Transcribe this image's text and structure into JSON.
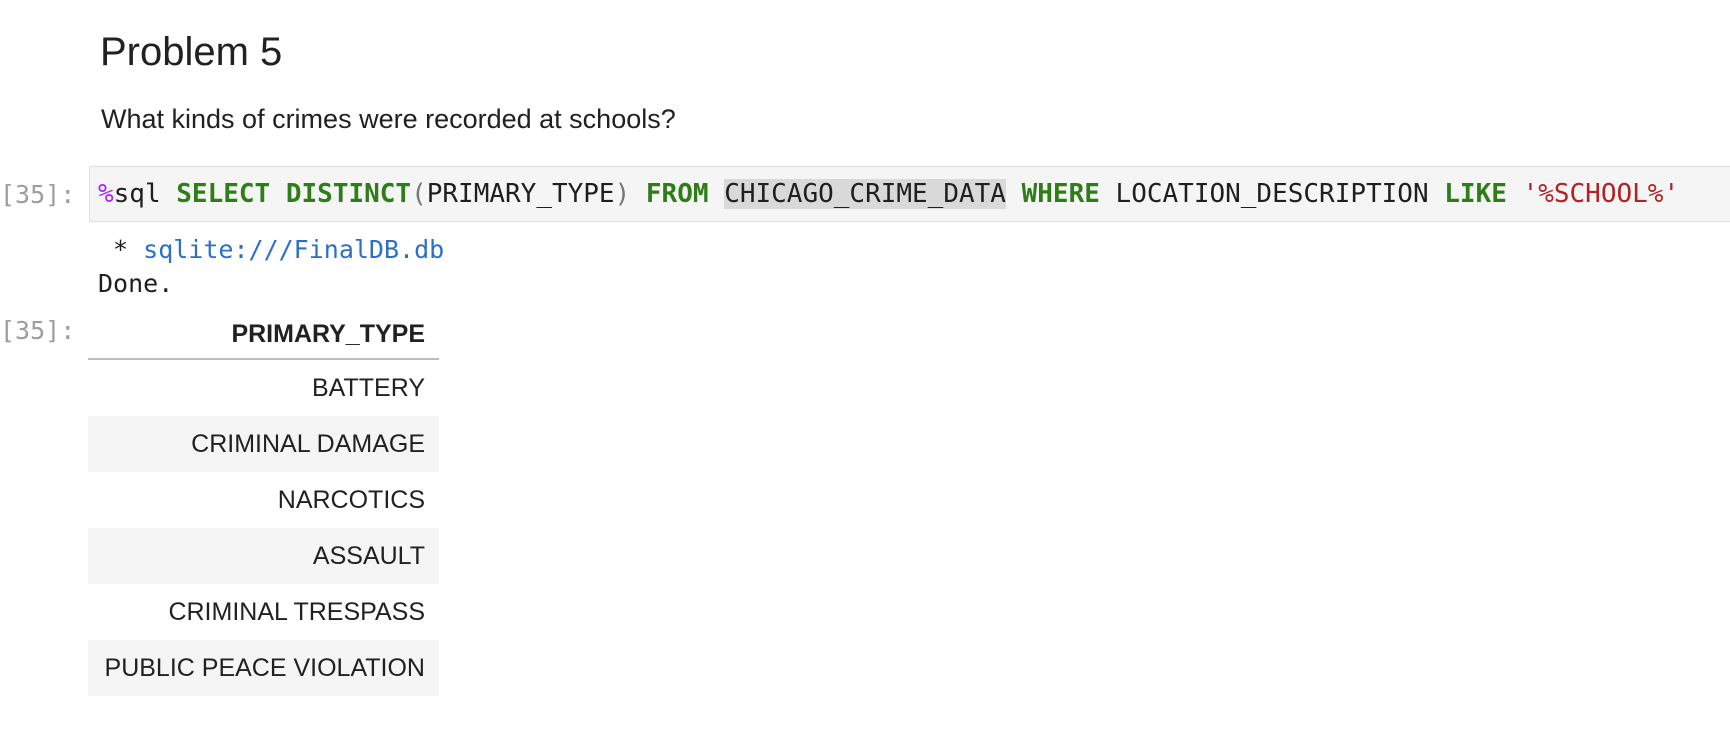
{
  "markdown": {
    "heading": "Problem 5",
    "question": "What kinds of crimes were recorded at schools?"
  },
  "code_cell": {
    "in_prompt": "[35]:",
    "tokens": {
      "magic": "%",
      "magic_name": "sql",
      "kw_select": "SELECT",
      "kw_distinct": "DISTINCT",
      "paren_open": "(",
      "column": "PRIMARY_TYPE",
      "paren_close": ")",
      "kw_from": "FROM",
      "table": "CHICAGO_CRIME_DATA",
      "kw_where": "WHERE",
      "filter_column": "LOCATION_DESCRIPTION",
      "kw_like": "LIKE",
      "pattern": "'%SCHOOL%'"
    }
  },
  "output": {
    "bullet": " * ",
    "connection": "sqlite:///FinalDB.db",
    "status": "Done.",
    "out_prompt": "[35]:",
    "table": {
      "header": "PRIMARY_TYPE",
      "rows": [
        "BATTERY",
        "CRIMINAL DAMAGE",
        "NARCOTICS",
        "ASSAULT",
        "CRIMINAL TRESPASS",
        "PUBLIC PEACE VIOLATION"
      ]
    }
  },
  "colors": {
    "keyword": "#2e7d18",
    "magic": "#aa22ff",
    "string": "#b22222",
    "link": "#2c6fc9",
    "prompt": "#9e9e9e",
    "cell_background": "#f5f5f5",
    "selection": "#d9d9d9"
  }
}
